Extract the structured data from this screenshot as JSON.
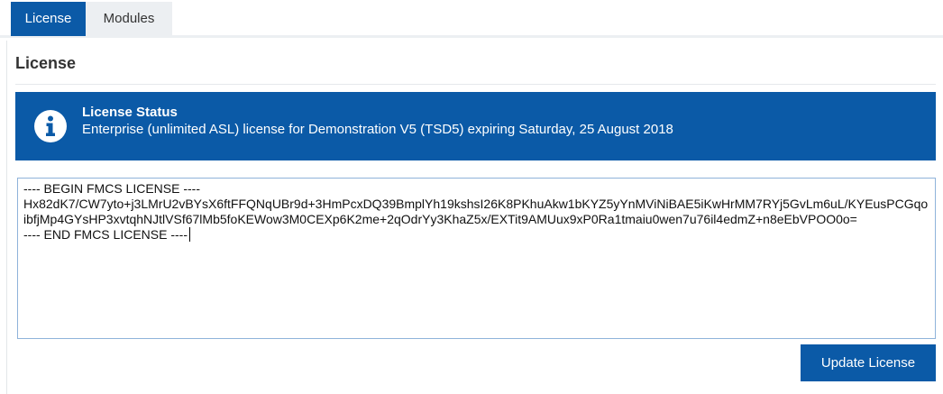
{
  "tabs": [
    {
      "label": "License",
      "active": true
    },
    {
      "label": "Modules",
      "active": false
    }
  ],
  "page_title": "License",
  "status": {
    "icon": "info-icon",
    "title": "License Status",
    "text": "Enterprise (unlimited ASL) license for Demonstration V5 (TSD5) expiring Saturday, 25 August 2018"
  },
  "license_text": "---- BEGIN FMCS LICENSE ----\nHx82dK7/CW7yto+j3LMrU2vBYsX6ftFFQNqUBr9d+3HmPcxDQ39BmplYh19kshsI26K8PKhuAkw1bKYZ5yYnMViNiBAE5iKwHrMM7RYj5GvLm6uL/KYEusPCGqoibfjMp4GYsHP3xvtqhNJtlVSf67lMb5foKEWow3M0CEXp6K2me+2qOdrYy3KhaZ5x/EXTit9AMUux9xP0Ra1tmaiu0wen7u76il4edmZ+n8eEbVPOO0o=\n---- END FMCS LICENSE ----",
  "update_button_label": "Update License",
  "colors": {
    "accent": "#0b5aa7",
    "tab_inactive": "#eceff2"
  }
}
